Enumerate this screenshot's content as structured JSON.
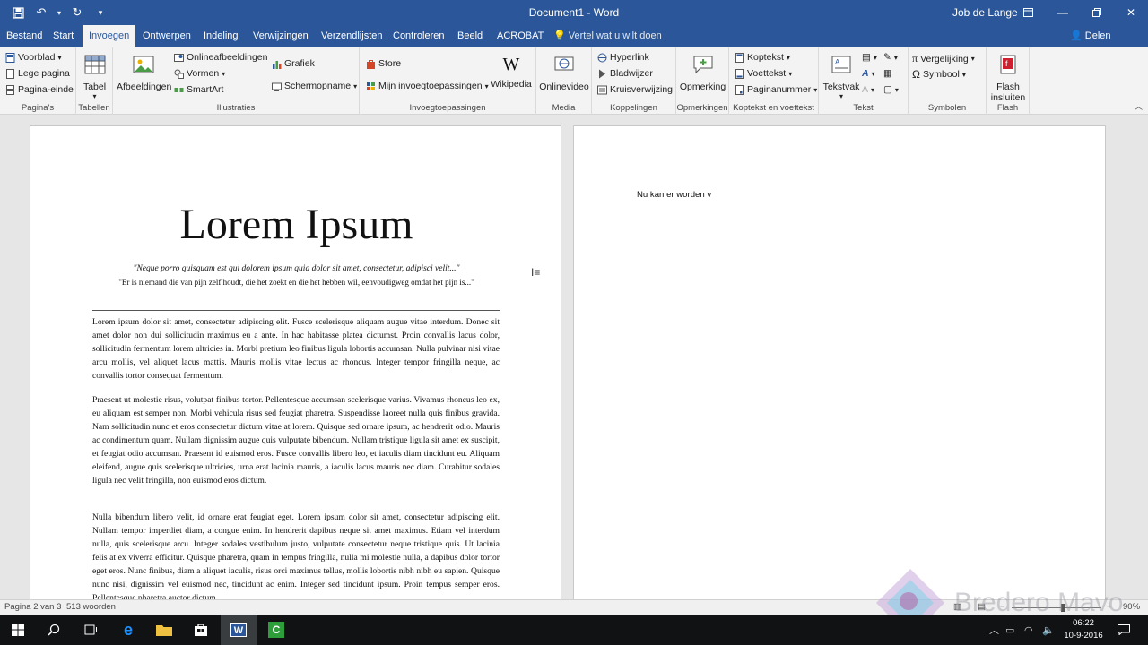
{
  "titlebar": {
    "title": "Document1 - Word",
    "user": "Job de Lange"
  },
  "tabs": [
    {
      "label": "Bestand"
    },
    {
      "label": "Start"
    },
    {
      "label": "Invoegen"
    },
    {
      "label": "Ontwerpen"
    },
    {
      "label": "Indeling"
    },
    {
      "label": "Verwijzingen"
    },
    {
      "label": "Verzendlijsten"
    },
    {
      "label": "Controleren"
    },
    {
      "label": "Beeld"
    },
    {
      "label": "ACROBAT"
    }
  ],
  "active_tab": "Invoegen",
  "tellme": "Vertel wat u wilt doen",
  "share": "Delen",
  "ribbon": {
    "paginas": {
      "label": "Pagina's",
      "items": [
        "Voorblad",
        "Lege pagina",
        "Pagina-einde"
      ]
    },
    "tabellen": {
      "label": "Tabellen",
      "tabel": "Tabel"
    },
    "illustraties": {
      "label": "Illustraties",
      "afbeeldingen": "Afbeeldingen",
      "online": "Onlineafbeeldingen",
      "vormen": "Vormen",
      "smartart": "SmartArt",
      "grafiek": "Grafiek",
      "schermopname": "Schermopname"
    },
    "invoeg": {
      "label": "Invoegtoepassingen",
      "store": "Store",
      "mijn": "Mijn invoegtoepassingen",
      "wikipedia": "Wikipedia"
    },
    "media": {
      "label": "Media",
      "onlinevideo": "Onlinevideo"
    },
    "koppelingen": {
      "label": "Koppelingen",
      "items": [
        "Hyperlink",
        "Bladwijzer",
        "Kruisverwijzing"
      ]
    },
    "opmerkingen": {
      "label": "Opmerkingen",
      "opmerking": "Opmerking"
    },
    "koptekst": {
      "label": "Koptekst en voettekst",
      "items": [
        "Koptekst",
        "Voettekst",
        "Paginanummer"
      ]
    },
    "tekst": {
      "label": "Tekst",
      "tekstvak": "Tekstvak"
    },
    "symbolen": {
      "label": "Symbolen",
      "items": [
        "Vergelijking",
        "Symbool"
      ]
    },
    "flash": {
      "label": "Flash",
      "line1": "Flash",
      "line2": "insluiten"
    }
  },
  "document": {
    "heading": "Lorem Ipsum",
    "quote1": "\"Neque porro quisquam est qui dolorem ipsum quia dolor sit amet, consectetur, adipisci velit...\"",
    "quote2": "\"Er is niemand die van pijn zelf houdt, die het zoekt en die het hebben wil, eenvoudigweg omdat het pijn is...\"",
    "paragraphs": [
      "Lorem ipsum dolor sit amet, consectetur adipiscing elit. Fusce scelerisque aliquam augue vitae interdum. Donec sit amet dolor non dui sollicitudin maximus eu a ante. In hac habitasse platea dictumst. Proin convallis lacus dolor, sollicitudin fermentum lorem ultricies in. Morbi pretium leo finibus ligula lobortis accumsan. Nulla pulvinar nisi vitae arcu mollis, vel aliquet lacus mattis. Mauris mollis vitae lectus ac rhoncus. Integer tempor fringilla neque, ac convallis tortor consequat fermentum.",
      "Praesent ut molestie risus, volutpat finibus tortor. Pellentesque accumsan scelerisque varius. Vivamus rhoncus leo ex, eu aliquam est semper non. Morbi vehicula risus sed feugiat pharetra. Suspendisse laoreet nulla quis finibus gravida. Nam sollicitudin nunc et eros consectetur dictum vitae at lorem. Quisque sed ornare ipsum, ac hendrerit odio. Mauris ac condimentum quam. Nullam dignissim augue quis vulputate bibendum. Nullam tristique ligula sit amet ex suscipit, et feugiat odio accumsan. Praesent id euismod eros. Fusce convallis libero leo, et iaculis diam tincidunt eu. Aliquam eleifend, augue quis scelerisque ultricies, urna erat lacinia mauris, a iaculis lacus mauris nec diam. Curabitur sodales ligula nec velit fringilla, non euismod eros dictum.",
      "Nulla bibendum libero velit, id ornare erat feugiat eget. Lorem ipsum dolor sit amet, consectetur adipiscing elit. Nullam tempor imperdiet diam, a congue enim. In hendrerit dapibus neque sit amet maximus. Etiam vel interdum nulla, quis scelerisque arcu. Integer sodales vestibulum justo, vulputate consectetur neque tristique quis. Ut lacinia felis at ex viverra efficitur. Quisque pharetra, quam in tempus fringilla, nulla mi molestie nulla, a dapibus dolor tortor eget eros. Nunc finibus, diam a aliquet iaculis, risus orci maximus tellus, mollis lobortis nibh nibh eu sapien. Quisque nunc nisi, dignissim vel euismod nec, tincidunt ac enim. Integer sed tincidunt ipsum. Proin tempus semper eros. Pellentesque pharetra auctor dictum."
    ],
    "page2_text": "Nu kan er worden v"
  },
  "statusbar": {
    "page": "Pagina 2 van 3",
    "words": "513 woorden",
    "zoom": "90%"
  },
  "watermark": "Bredero Mavo",
  "taskbar": {
    "time": "06:22",
    "date": "10-9-2016"
  },
  "colors": {
    "word_blue": "#2b579a",
    "ribbon_bg": "#f3f3f3"
  }
}
